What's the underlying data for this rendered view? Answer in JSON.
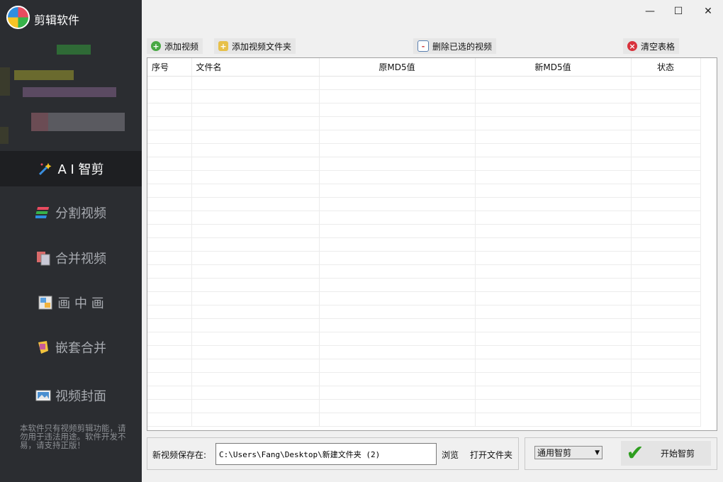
{
  "app": {
    "title": "剪辑软件"
  },
  "sidebar": {
    "items": [
      {
        "label": "A I 智剪",
        "icon": "magic-wand-icon",
        "active": true
      },
      {
        "label": "分割视频",
        "icon": "split-layers-icon"
      },
      {
        "label": "合并视频",
        "icon": "merge-files-icon"
      },
      {
        "label": "画 中 画",
        "icon": "picture-in-picture-icon"
      },
      {
        "label": "嵌套合并",
        "icon": "nest-merge-icon"
      },
      {
        "label": "视频封面",
        "icon": "video-cover-icon"
      }
    ],
    "note": "本软件只有视频剪辑功能，请勿用于违法用途。软件开发不易，请支持正版！"
  },
  "window": {
    "minimize": "—",
    "maximize": "☐",
    "close": "✕"
  },
  "toolbar": {
    "add_video": "添加视频",
    "add_folder": "添加视频文件夹",
    "delete_selected": "删除已选的视频",
    "clear_table": "清空表格"
  },
  "table": {
    "columns": [
      "序号",
      "文件名",
      "原MD5值",
      "新MD5值",
      "状态"
    ],
    "rows": []
  },
  "bottom": {
    "save_label": "新视频保存在:",
    "save_path": "C:\\Users\\Fang\\Desktop\\新建文件夹 (2)",
    "browse": "浏览",
    "open_folder": "打开文件夹",
    "mode_selected": "通用智剪",
    "start": "开始智剪"
  },
  "colors": {
    "sidebar_bg": "#2b2d31",
    "active_bg": "#1e1f22",
    "accent_green": "#2e9e1f"
  }
}
